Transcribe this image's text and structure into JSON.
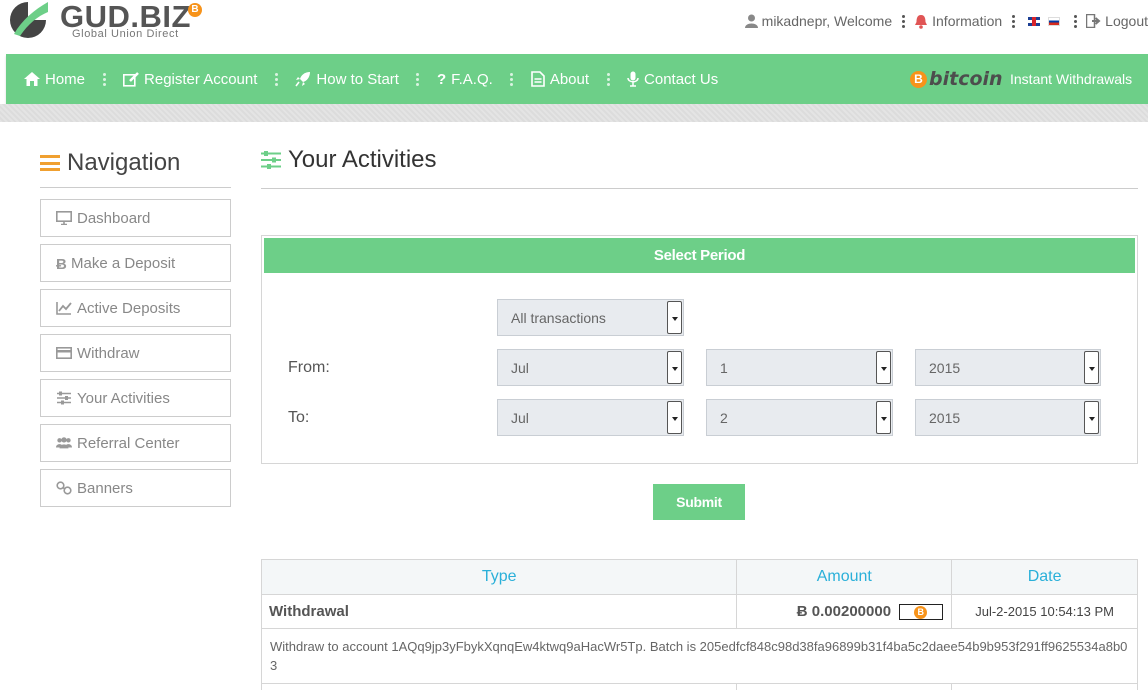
{
  "brand": {
    "name": "GUD.BIZ",
    "badge": "B",
    "tagline": "Global Union Direct"
  },
  "user_nav": {
    "welcome": "mikadnepr, Welcome",
    "information": "Information",
    "logout": "Logout"
  },
  "main_nav": {
    "items": [
      {
        "label": "Home",
        "icon": "home-icon"
      },
      {
        "label": "Register Account",
        "icon": "edit-icon"
      },
      {
        "label": "How to Start",
        "icon": "rocket-icon"
      },
      {
        "label": "F.A.Q.",
        "icon": "question-icon"
      },
      {
        "label": "About",
        "icon": "document-icon"
      },
      {
        "label": "Contact Us",
        "icon": "microphone-icon"
      }
    ],
    "bitcoin_logo": "bitcoin",
    "bitcoin_coin": "B",
    "instant": "Instant Withdrawals"
  },
  "sidebar": {
    "title": "Navigation",
    "items": [
      {
        "label": "Dashboard",
        "icon": "monitor-icon"
      },
      {
        "label": "Make a Deposit",
        "icon": "bitcoin-icon"
      },
      {
        "label": "Active Deposits",
        "icon": "chart-icon"
      },
      {
        "label": "Withdraw",
        "icon": "card-icon"
      },
      {
        "label": "Your Activities",
        "icon": "sliders-icon"
      },
      {
        "label": "Referral Center",
        "icon": "users-icon"
      },
      {
        "label": "Banners",
        "icon": "link-icon"
      }
    ]
  },
  "main": {
    "title": "Your Activities",
    "period": {
      "header": "Select Period",
      "type_select": "All transactions",
      "from_label": "From:",
      "to_label": "To:",
      "from": {
        "month": "Jul",
        "day": "1",
        "year": "2015"
      },
      "to": {
        "month": "Jul",
        "day": "2",
        "year": "2015"
      },
      "submit": "Submit"
    },
    "table": {
      "headers": {
        "type": "Type",
        "amount": "Amount",
        "date": "Date"
      },
      "rows": [
        {
          "type": "Withdrawal",
          "amount": "Ƀ 0.00200000",
          "coin": "B",
          "date": "Jul-2-2015 10:54:13 PM",
          "description": "Withdraw to account 1AQq9jp3yFbykXqnqEw4ktwq9aHacWr5Tp. Batch is 205edfcf848c98d38fa96899b31f4ba5c2daee54b9b953f291ff9625534a8b03"
        }
      ]
    }
  },
  "colors": {
    "accent": "#6dcf88",
    "header_text": "#2ab0d9",
    "bitcoin": "#f7931a",
    "nav_orange": "#f0a030"
  }
}
